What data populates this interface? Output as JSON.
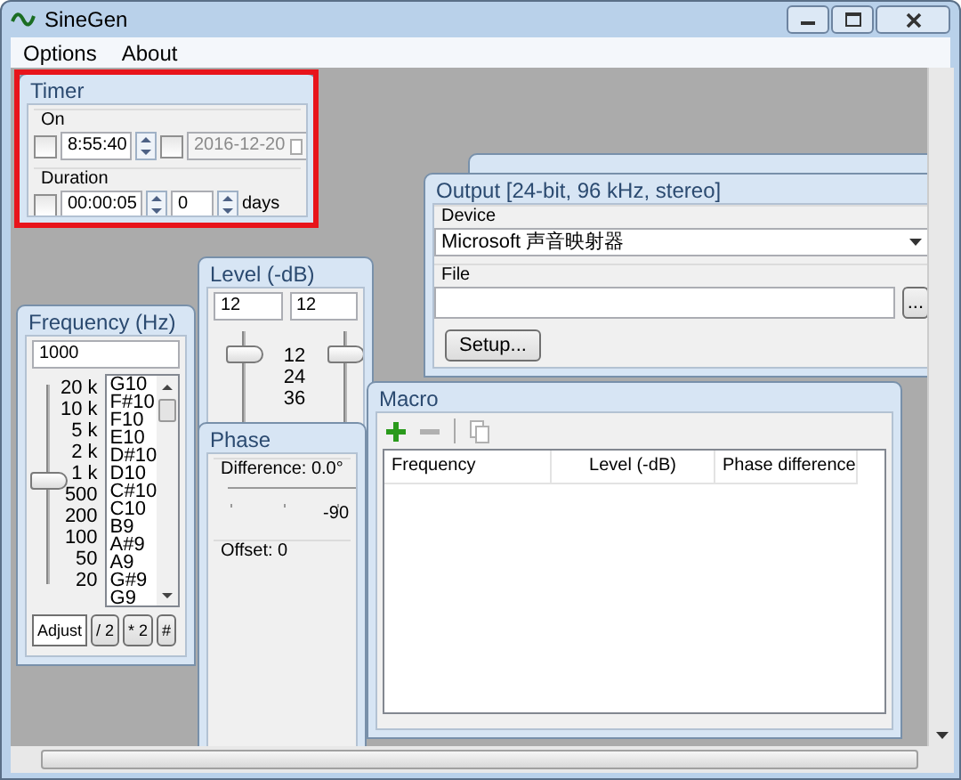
{
  "window": {
    "title": "SineGen"
  },
  "menu": [
    {
      "label": "Options"
    },
    {
      "label": "About"
    }
  ],
  "timer": {
    "title": "Timer",
    "highlighted": true,
    "on": {
      "label": "On",
      "time_checked": false,
      "time": "8:55:40",
      "date_checked": false,
      "date": "2016-12-20",
      "date_disabled": true
    },
    "duration": {
      "label": "Duration",
      "checked": false,
      "time": "00:00:05",
      "days_value": "0",
      "days_unit": "days"
    }
  },
  "output": {
    "title": "Output [24-bit, 96 kHz, stereo]",
    "device_label": "Device",
    "device": "Microsoft 声音映射器",
    "file_label": "File",
    "file_browse": "...",
    "setup_button": "Setup..."
  },
  "level": {
    "title": "Level (-dB)",
    "left_value": "12",
    "right_value": "12",
    "sliders": [
      {
        "level": 0.85
      },
      {
        "level": 0.85
      }
    ],
    "scale": [
      "12",
      "24",
      "36"
    ]
  },
  "frequency": {
    "title": "Frequency (Hz)",
    "value": "1000",
    "slider": {
      "level": 0.52
    },
    "scale": [
      "20 k",
      "10 k",
      "5 k",
      "2 k",
      "1 k",
      "500",
      "200",
      "100",
      "50",
      "20"
    ],
    "notes": [
      "G10",
      "F#10",
      "F10",
      "E10",
      "D#10",
      "D10",
      "C#10",
      "C10",
      "B9",
      "A#9",
      "A9",
      "G#9",
      "G9"
    ],
    "buttons": [
      "Adjust",
      "/ 2",
      "* 2",
      "#"
    ]
  },
  "phase": {
    "title": "Phase",
    "difference": "Difference: 0.0°",
    "tick_label": "-90",
    "offset": "Offset: 0"
  },
  "macro": {
    "title": "Macro",
    "toolbar": [
      {
        "kind": "add",
        "disabled": false
      },
      {
        "kind": "remove",
        "disabled": true
      },
      {
        "kind": "separator"
      },
      {
        "kind": "copy",
        "disabled": true
      }
    ],
    "columns": [
      "Frequency",
      "Level (-dB)",
      "Phase difference"
    ]
  }
}
